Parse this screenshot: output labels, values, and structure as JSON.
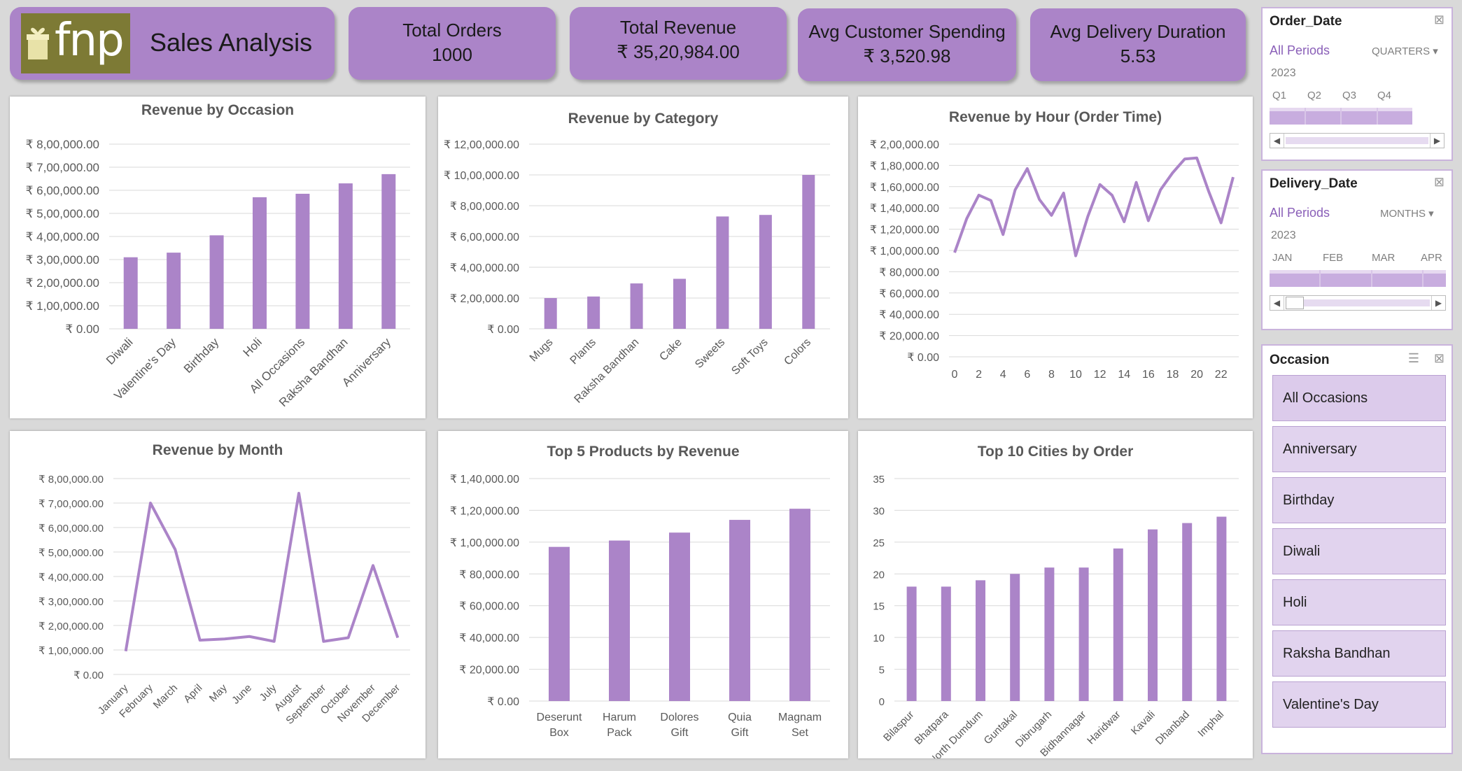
{
  "brand": {
    "logo_text": "fnp",
    "title": "Sales Analysis"
  },
  "kpis": [
    {
      "label": "Total Orders",
      "value": "1000"
    },
    {
      "label": "Total Revenue",
      "value": "₹ 35,20,984.00"
    },
    {
      "label": "Avg Customer Spending",
      "value": "₹ 3,520.98"
    },
    {
      "label": "Avg Delivery Duration",
      "value": "5.53"
    }
  ],
  "slicers": {
    "order_date": {
      "title": "Order_Date",
      "selection": "All Periods",
      "unit": "QUARTERS",
      "year": "2023",
      "ticks": [
        "Q1",
        "Q2",
        "Q3",
        "Q4"
      ]
    },
    "delivery_date": {
      "title": "Delivery_Date",
      "selection": "All Periods",
      "unit": "MONTHS",
      "year": "2023",
      "ticks": [
        "JAN",
        "FEB",
        "MAR",
        "APR"
      ]
    },
    "occasion": {
      "title": "Occasion",
      "items": [
        "All Occasions",
        "Anniversary",
        "Birthday",
        "Diwali",
        "Holi",
        "Raksha Bandhan",
        "Valentine's Day"
      ]
    }
  },
  "colors": {
    "accent": "#ab84c8",
    "grid": "#d9d9d9",
    "axis_text": "#595959",
    "background": "#d9d9d9"
  },
  "chart_data": [
    {
      "id": "occasion",
      "type": "bar",
      "title": "Revenue by Occasion",
      "categories": [
        "Diwali",
        "Valentine's Day",
        "Birthday",
        "Holi",
        "All Occasions",
        "Raksha Bandhan",
        "Anniversary"
      ],
      "values": [
        310000,
        330000,
        405000,
        570000,
        585000,
        630000,
        670000
      ],
      "ylim": [
        0,
        800000
      ],
      "yticks": [
        "₹ 0.00",
        "₹ 1,00,000.00",
        "₹ 2,00,000.00",
        "₹ 3,00,000.00",
        "₹ 4,00,000.00",
        "₹ 5,00,000.00",
        "₹ 6,00,000.00",
        "₹ 7,00,000.00",
        "₹ 8,00,000.00"
      ],
      "grid": true
    },
    {
      "id": "category",
      "type": "bar",
      "title": "Revenue by Category",
      "categories": [
        "Mugs",
        "Plants",
        "Raksha Bandhan",
        "Cake",
        "Sweets",
        "Soft Toys",
        "Colors"
      ],
      "values": [
        200000,
        210000,
        295000,
        325000,
        730000,
        740000,
        1000000
      ],
      "ylim": [
        0,
        1200000
      ],
      "yticks": [
        "₹ 0.00",
        "₹ 2,00,000.00",
        "₹ 4,00,000.00",
        "₹ 6,00,000.00",
        "₹ 8,00,000.00",
        "₹ 10,00,000.00",
        "₹ 12,00,000.00"
      ],
      "grid": true
    },
    {
      "id": "hour",
      "type": "line",
      "title": "Revenue by Hour (Order Time)",
      "x": [
        0,
        1,
        2,
        3,
        4,
        5,
        6,
        7,
        8,
        9,
        10,
        11,
        12,
        13,
        14,
        15,
        16,
        17,
        18,
        19,
        20,
        21,
        22,
        23
      ],
      "values": [
        98000,
        130000,
        152000,
        147000,
        115000,
        157000,
        177000,
        148000,
        133000,
        154000,
        95000,
        132000,
        162000,
        152000,
        127000,
        164000,
        128000,
        157000,
        173000,
        186000,
        187000,
        155000,
        126000,
        169000
      ],
      "xticks": [
        "0",
        "2",
        "4",
        "6",
        "8",
        "10",
        "12",
        "14",
        "16",
        "18",
        "20",
        "22"
      ],
      "ylim": [
        0,
        200000
      ],
      "yticks": [
        "₹ 0.00",
        "₹ 20,000.00",
        "₹ 40,000.00",
        "₹ 60,000.00",
        "₹ 80,000.00",
        "₹ 1,00,000.00",
        "₹ 1,20,000.00",
        "₹ 1,40,000.00",
        "₹ 1,60,000.00",
        "₹ 1,80,000.00",
        "₹ 2,00,000.00"
      ],
      "grid": true
    },
    {
      "id": "month",
      "type": "line",
      "title": "Revenue by Month",
      "categories": [
        "January",
        "February",
        "March",
        "April",
        "May",
        "June",
        "July",
        "August",
        "September",
        "October",
        "November",
        "December"
      ],
      "values": [
        95000,
        700000,
        510000,
        140000,
        145000,
        155000,
        135000,
        740000,
        135000,
        150000,
        445000,
        150000
      ],
      "ylim": [
        0,
        800000
      ],
      "yticks": [
        "₹ 0.00",
        "₹ 1,00,000.00",
        "₹ 2,00,000.00",
        "₹ 3,00,000.00",
        "₹ 4,00,000.00",
        "₹ 5,00,000.00",
        "₹ 6,00,000.00",
        "₹ 7,00,000.00",
        "₹ 8,00,000.00"
      ],
      "grid": true
    },
    {
      "id": "products",
      "type": "bar",
      "title": "Top 5 Products by Revenue",
      "categories": [
        "Deserunt Box",
        "Harum Pack",
        "Dolores Gift",
        "Quia Gift",
        "Magnam Set"
      ],
      "values": [
        97000,
        101000,
        106000,
        114000,
        121000
      ],
      "ylim": [
        0,
        140000
      ],
      "yticks": [
        "₹ 0.00",
        "₹ 20,000.00",
        "₹ 40,000.00",
        "₹ 60,000.00",
        "₹ 80,000.00",
        "₹ 1,00,000.00",
        "₹ 1,20,000.00",
        "₹ 1,40,000.00"
      ],
      "grid": true
    },
    {
      "id": "cities",
      "type": "bar",
      "title": "Top 10 Cities by Order",
      "categories": [
        "Bilaspur",
        "Bhatpara",
        "North Dumdum",
        "Guntakal",
        "Dibrugarh",
        "Bidhannagar",
        "Haridwar",
        "Kavali",
        "Dhanbad",
        "Imphal"
      ],
      "values": [
        18,
        18,
        19,
        20,
        21,
        21,
        24,
        27,
        28,
        29
      ],
      "ylim": [
        0,
        35
      ],
      "yticks": [
        "0",
        "5",
        "10",
        "15",
        "20",
        "25",
        "30",
        "35"
      ],
      "grid": true
    }
  ]
}
